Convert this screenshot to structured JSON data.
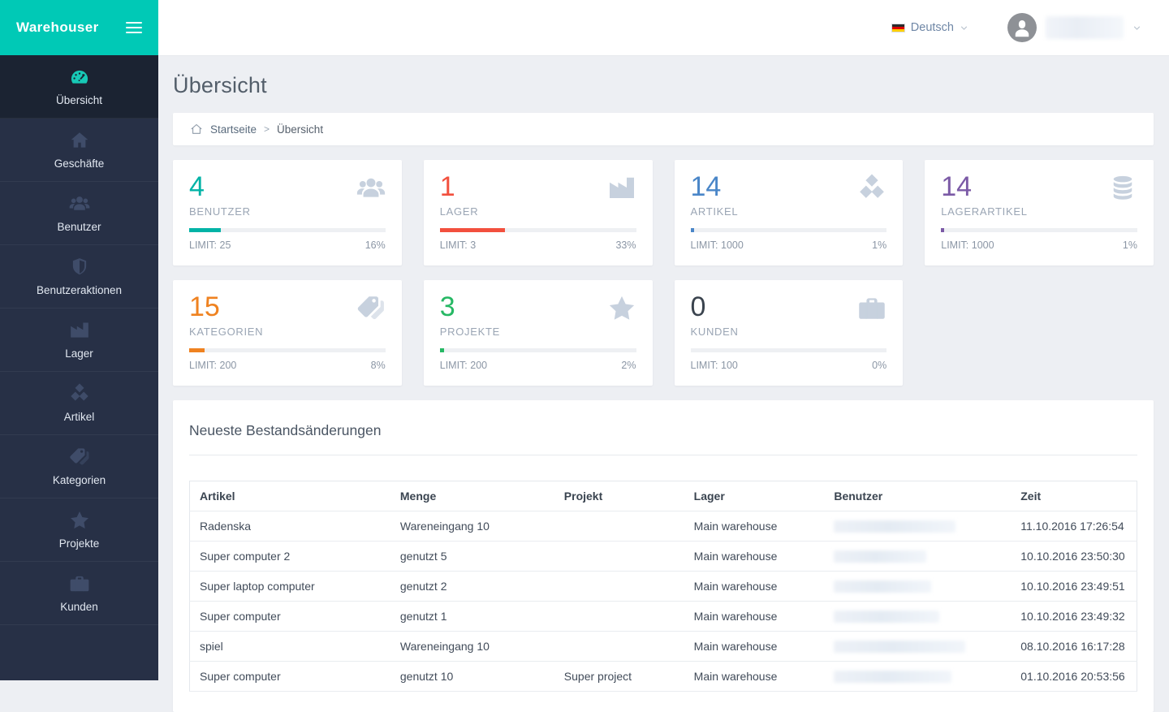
{
  "app": {
    "name": "Warehouser"
  },
  "theme": {
    "accent_teal": "#00c9b6",
    "sidebar_bg": "#273046",
    "sidebar_active_bg": "#1b2332",
    "content_bg": "#edeff3"
  },
  "topbar": {
    "language": {
      "label": "Deutsch",
      "flag_icon": "german-flag-icon"
    },
    "user": {
      "name_redacted": true
    }
  },
  "sidebar": {
    "items": [
      {
        "id": "uebersicht",
        "label": "Übersicht",
        "icon": "dashboard-icon",
        "active": true
      },
      {
        "id": "geschaefte",
        "label": "Geschäfte",
        "icon": "home-icon",
        "active": false
      },
      {
        "id": "benutzer",
        "label": "Benutzer",
        "icon": "users-icon",
        "active": false
      },
      {
        "id": "benutzeraktionen",
        "label": "Benutzeraktionen",
        "icon": "shield-icon",
        "active": false
      },
      {
        "id": "lager",
        "label": "Lager",
        "icon": "factory-icon",
        "active": false
      },
      {
        "id": "artikel",
        "label": "Artikel",
        "icon": "cubes-icon",
        "active": false
      },
      {
        "id": "kategorien",
        "label": "Kategorien",
        "icon": "tags-icon",
        "active": false
      },
      {
        "id": "projekte",
        "label": "Projekte",
        "icon": "star-icon",
        "active": false
      },
      {
        "id": "kunden",
        "label": "Kunden",
        "icon": "briefcase-icon",
        "active": false
      }
    ]
  },
  "page": {
    "title": "Übersicht"
  },
  "breadcrumb": {
    "home_icon": "home-outline-icon",
    "items": [
      "Startseite",
      "Übersicht"
    ],
    "separator": ">"
  },
  "stats_cards": [
    {
      "value": "4",
      "label": "BENUTZER",
      "icon": "users-icon",
      "limit_text": "LIMIT: 25",
      "percent_text": "16%",
      "percent": 16,
      "color": "#00b3a6"
    },
    {
      "value": "1",
      "label": "LAGER",
      "icon": "factory-icon",
      "limit_text": "LIMIT: 3",
      "percent_text": "33%",
      "percent": 33,
      "color": "#f2503e"
    },
    {
      "value": "14",
      "label": "ARTIKEL",
      "icon": "cubes-icon",
      "limit_text": "LIMIT: 1000",
      "percent_text": "1%",
      "percent": 1,
      "color": "#4a86c8"
    },
    {
      "value": "14",
      "label": "LAGERARTIKEL",
      "icon": "database-icon",
      "limit_text": "LIMIT: 1000",
      "percent_text": "1%",
      "percent": 1,
      "color": "#7b5aa6"
    },
    {
      "value": "15",
      "label": "KATEGORIEN",
      "icon": "tags-icon",
      "limit_text": "LIMIT: 200",
      "percent_text": "8%",
      "percent": 8,
      "color": "#ef8220"
    },
    {
      "value": "3",
      "label": "PROJEKTE",
      "icon": "star-icon",
      "limit_text": "LIMIT: 200",
      "percent_text": "2%",
      "percent": 2,
      "color": "#26b864"
    },
    {
      "value": "0",
      "label": "KUNDEN",
      "icon": "briefcase-icon",
      "limit_text": "LIMIT: 100",
      "percent_text": "0%",
      "percent": 0,
      "color": "#3a434e"
    }
  ],
  "panel": {
    "title": "Neueste Bestandsänderungen",
    "table": {
      "headers": [
        "Artikel",
        "Menge",
        "Projekt",
        "Lager",
        "Benutzer",
        "Zeit"
      ],
      "rows": [
        {
          "artikel": "Radenska",
          "menge": "Wareneingang 10",
          "projekt": "",
          "lager": "Main warehouse",
          "benutzer_redacted": true,
          "zeit": "11.10.2016 17:26:54"
        },
        {
          "artikel": "Super computer 2",
          "menge": "genutzt 5",
          "projekt": "",
          "lager": "Main warehouse",
          "benutzer_redacted": true,
          "zeit": "10.10.2016 23:50:30"
        },
        {
          "artikel": "Super laptop computer",
          "menge": "genutzt 2",
          "projekt": "",
          "lager": "Main warehouse",
          "benutzer_redacted": true,
          "zeit": "10.10.2016 23:49:51"
        },
        {
          "artikel": "Super computer",
          "menge": "genutzt 1",
          "projekt": "",
          "lager": "Main warehouse",
          "benutzer_redacted": true,
          "zeit": "10.10.2016 23:49:32"
        },
        {
          "artikel": "spiel",
          "menge": "Wareneingang 10",
          "projekt": "",
          "lager": "Main warehouse",
          "benutzer_redacted": true,
          "zeit": "08.10.2016 16:17:28"
        },
        {
          "artikel": "Super computer",
          "menge": "genutzt 10",
          "projekt": "Super project",
          "lager": "Main warehouse",
          "benutzer_redacted": true,
          "zeit": "01.10.2016 20:53:56"
        }
      ]
    }
  }
}
